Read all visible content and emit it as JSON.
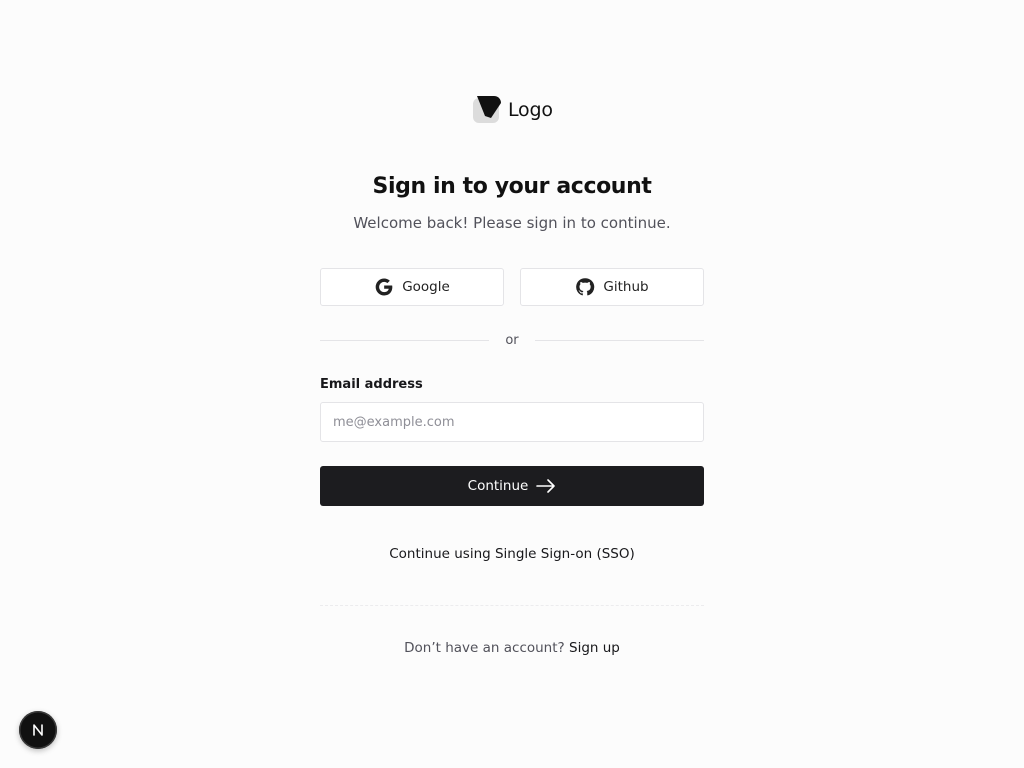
{
  "logo": {
    "text": "Logo"
  },
  "heading": {
    "title": "Sign in to your account",
    "subtitle": "Welcome back! Please sign in to continue."
  },
  "social": {
    "google_label": "Google",
    "github_label": "Github"
  },
  "divider": {
    "text": "or"
  },
  "form": {
    "email_label": "Email address",
    "email_placeholder": "me@example.com",
    "email_value": "",
    "continue_label": "Continue"
  },
  "sso": {
    "label": "Continue using Single Sign-on (SSO)"
  },
  "footer": {
    "prompt": "Don’t have an account?",
    "signup_label": "Sign up"
  },
  "dev_badge": {
    "letter": "N"
  },
  "colors": {
    "primary_button": "#1c1c1f",
    "border": "#e4e4e7",
    "muted_text": "#52525b",
    "background": "#fcfcfc"
  },
  "icons": [
    "logo-mark-icon",
    "google-icon",
    "github-icon",
    "arrow-right-icon",
    "nextjs-icon"
  ]
}
